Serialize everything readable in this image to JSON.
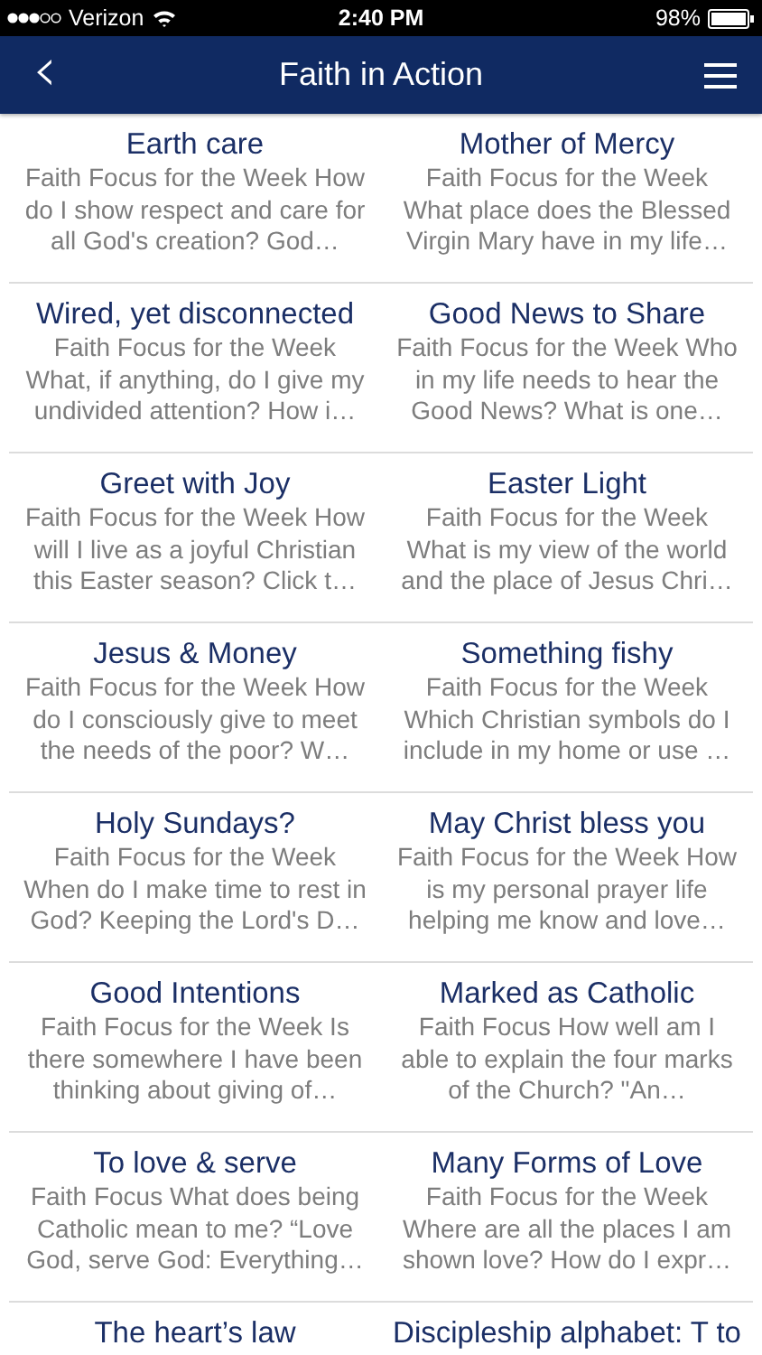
{
  "status_bar": {
    "carrier": "Verizon",
    "time": "2:40 PM",
    "battery": "98%"
  },
  "nav_bar": {
    "back": "‹",
    "title": "Faith in Action"
  },
  "articles": [
    {
      "title": "Earth care",
      "lines": [
        "Faith Focus for the Week How",
        "do I show respect and care for",
        "all God's creation? God…"
      ]
    },
    {
      "title": "Mother of Mercy",
      "lines": [
        "Faith Focus for the Week",
        "What place does the Blessed",
        "Virgin Mary have in my life…"
      ]
    },
    {
      "title": "Wired, yet disconnected",
      "lines": [
        "Faith Focus for the Week",
        "What, if anything, do I give my",
        "undivided attention? How i…"
      ]
    },
    {
      "title": "Good News to Share",
      "lines": [
        "Faith Focus for the Week Who",
        "in my life needs to hear the",
        "Good News? What is one…"
      ]
    },
    {
      "title": "Greet with Joy",
      "lines": [
        "Faith Focus for the Week How",
        "will I live as a joyful Christian",
        "this Easter season? Click t…"
      ]
    },
    {
      "title": "Easter Light",
      "lines": [
        "Faith Focus for the Week",
        "What is my view of the world",
        "and the place of Jesus Chri…"
      ]
    },
    {
      "title": "Jesus & Money",
      "lines": [
        "Faith Focus for the Week How",
        "do I consciously give to meet",
        "the needs of the poor? W…"
      ]
    },
    {
      "title": "Something fishy",
      "lines": [
        "Faith Focus for the Week",
        "Which Christian symbols do I",
        "include in my home or use …"
      ]
    },
    {
      "title": "Holy Sundays?",
      "lines": [
        "Faith Focus for the Week",
        "When do I make time to rest in",
        "God?  Keeping the Lord's D…"
      ]
    },
    {
      "title": "May Christ bless you",
      "lines": [
        "Faith Focus for the Week How",
        "is my personal prayer life",
        "helping me know and love…"
      ]
    },
    {
      "title": "Good Intentions",
      "lines": [
        "Faith Focus for the Week Is",
        "there somewhere I have been",
        "thinking about giving of…"
      ]
    },
    {
      "title": "Marked as Catholic",
      "lines": [
        "Faith Focus How well am I",
        "able to explain the four marks",
        "of the Church? \"An…"
      ]
    },
    {
      "title": "To love & serve",
      "lines": [
        "Faith Focus What does being",
        "Catholic mean to me? “Love",
        "God, serve God: Everything…"
      ]
    },
    {
      "title": "Many Forms of Love",
      "lines": [
        "Faith Focus for the Week",
        "Where are all the places I am",
        "shown love? How do I expr…"
      ]
    },
    {
      "title": "The heart’s law"
    },
    {
      "title": "Discipleship alphabet: T to"
    }
  ]
}
